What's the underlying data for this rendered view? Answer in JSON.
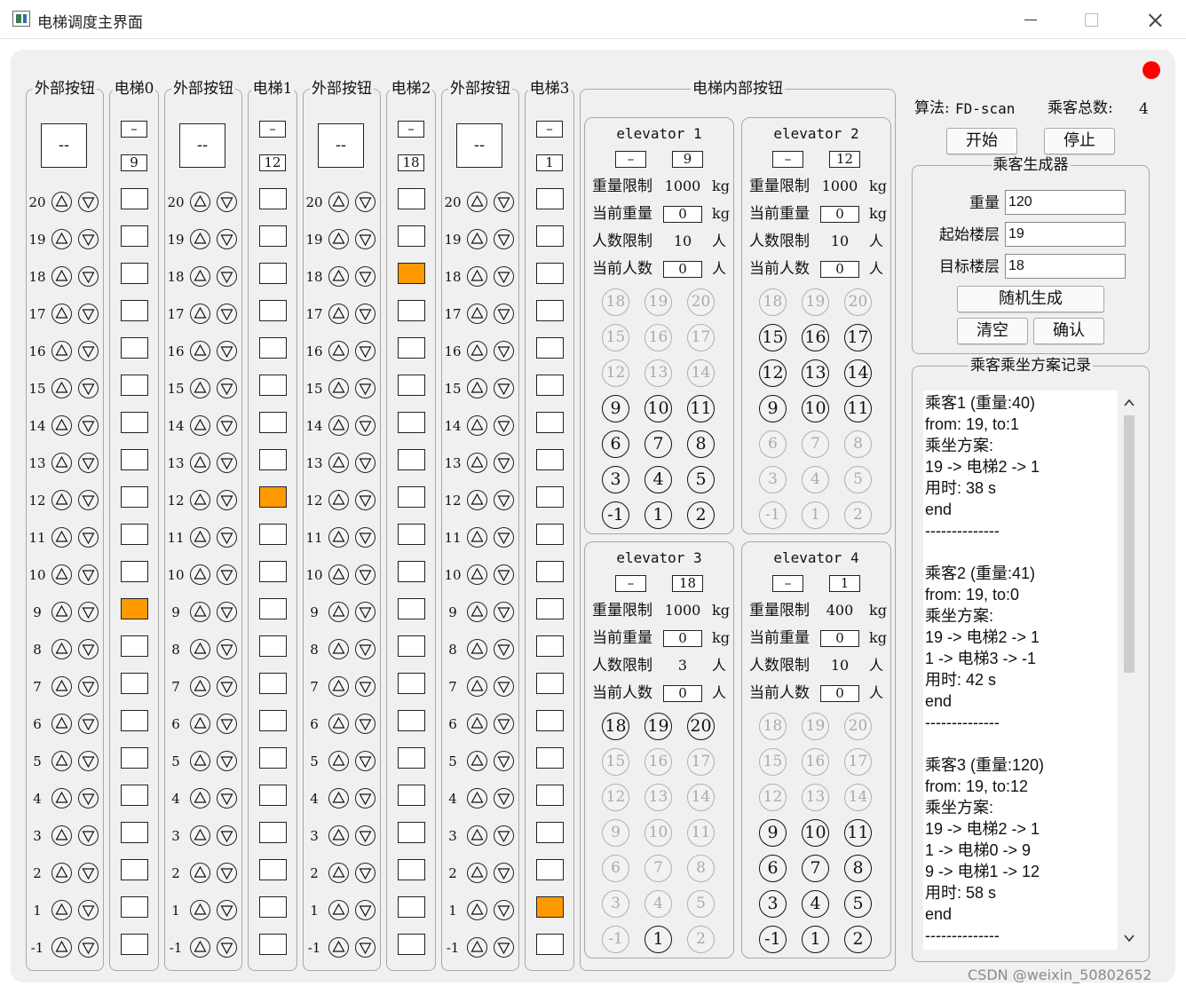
{
  "window": {
    "title": "电梯调度主界面"
  },
  "floors": [
    "20",
    "19",
    "18",
    "17",
    "16",
    "15",
    "14",
    "13",
    "12",
    "11",
    "10",
    "9",
    "8",
    "7",
    "6",
    "5",
    "4",
    "3",
    "2",
    "1",
    "-1"
  ],
  "external": {
    "group_label": "外部按钮",
    "display_text": "--"
  },
  "elevators": [
    {
      "label": "电梯0",
      "status": "–",
      "current_floor": "9",
      "active_floor": "9"
    },
    {
      "label": "电梯1",
      "status": "–",
      "current_floor": "12",
      "active_floor": "12"
    },
    {
      "label": "电梯2",
      "status": "–",
      "current_floor": "18",
      "active_floor": "18"
    },
    {
      "label": "电梯3",
      "status": "–",
      "current_floor": "1",
      "active_floor": "1"
    }
  ],
  "internal": {
    "group_label": "电梯内部按钮",
    "labels": {
      "weight_limit": "重量限制",
      "current_weight": "当前重量",
      "people_limit": "人数限制",
      "current_people": "当前人数",
      "kg": "kg",
      "person": "人"
    },
    "button_rows": [
      [
        "18",
        "19",
        "20"
      ],
      [
        "15",
        "16",
        "17"
      ],
      [
        "12",
        "13",
        "14"
      ],
      [
        "9",
        "10",
        "11"
      ],
      [
        "6",
        "7",
        "8"
      ],
      [
        "3",
        "4",
        "5"
      ],
      [
        "-1",
        "1",
        "2"
      ]
    ],
    "cars": [
      {
        "title": "elevator 1",
        "status": "–",
        "floor": "9",
        "weight_limit": "1000",
        "current_weight": "0",
        "people_limit": "10",
        "current_people": "0",
        "disabled": [
          "18",
          "19",
          "20",
          "15",
          "16",
          "17",
          "12",
          "13",
          "14"
        ]
      },
      {
        "title": "elevator 2",
        "status": "–",
        "floor": "12",
        "weight_limit": "1000",
        "current_weight": "0",
        "people_limit": "10",
        "current_people": "0",
        "disabled": [
          "18",
          "19",
          "20",
          "6",
          "7",
          "8",
          "3",
          "4",
          "5",
          "-1",
          "1",
          "2"
        ]
      },
      {
        "title": "elevator 3",
        "status": "–",
        "floor": "18",
        "weight_limit": "1000",
        "current_weight": "0",
        "people_limit": "3",
        "current_people": "0",
        "disabled": [
          "15",
          "16",
          "17",
          "12",
          "13",
          "14",
          "9",
          "10",
          "11",
          "6",
          "7",
          "8",
          "3",
          "4",
          "5",
          "-1",
          "2"
        ]
      },
      {
        "title": "elevator 4",
        "status": "–",
        "floor": "1",
        "weight_limit": "400",
        "current_weight": "0",
        "people_limit": "10",
        "current_people": "0",
        "disabled": [
          "18",
          "19",
          "20",
          "15",
          "16",
          "17",
          "12",
          "13",
          "14"
        ]
      }
    ]
  },
  "control": {
    "algorithm_label": "算法:",
    "algorithm_value": "FD-scan",
    "total_label": "乘客总数:",
    "total_value": "4",
    "start_label": "开始",
    "stop_label": "停止"
  },
  "generator": {
    "title": "乘客生成器",
    "weight_label": "重量",
    "weight_value": "120",
    "start_floor_label": "起始楼层",
    "start_floor_value": "19",
    "target_floor_label": "目标楼层",
    "target_floor_value": "18",
    "random_label": "随机生成",
    "clear_label": "清空",
    "confirm_label": "确认"
  },
  "log": {
    "title": "乘客乘坐方案记录",
    "text": "乘客1 (重量:40)\nfrom: 19, to:1\n乘坐方案:\n19 -> 电梯2 -> 1\n用时: 38 s\nend\n--------------\n\n乘客2 (重量:41)\nfrom: 19, to:0\n乘坐方案:\n19 -> 电梯2 -> 1\n1 -> 电梯3 -> -1\n用时: 42 s\nend\n--------------\n\n乘客3 (重量:120)\nfrom: 19, to:12\n乘坐方案:\n19 -> 电梯2 -> 1\n1 -> 电梯0 -> 9\n9 -> 电梯1 -> 12\n用时: 58 s\nend\n--------------"
  },
  "watermark": "CSDN @weixin_50802652",
  "colors": {
    "active_floor": "#ff9900",
    "status_dot": "#ff0000",
    "panel_bg": "#f0f0f0"
  }
}
